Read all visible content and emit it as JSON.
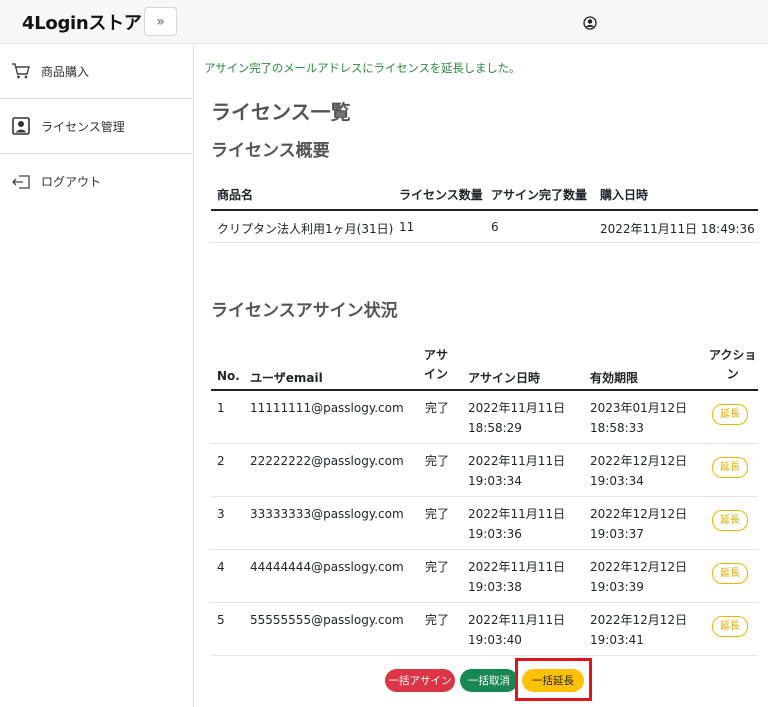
{
  "header": {
    "brand": "4Loginストア",
    "toggle_icon": "chevron-double-right-icon",
    "user_icon": "user-circle-icon"
  },
  "sidebar": {
    "items": [
      {
        "label": "商品購入",
        "icon": "cart-icon"
      },
      {
        "label": "ライセンス管理",
        "icon": "person-badge-icon"
      },
      {
        "label": "ログアウト",
        "icon": "logout-icon"
      }
    ]
  },
  "main": {
    "alert": "アサイン完了のメールアドレスにライセンスを延長しました。",
    "title": "ライセンス一覧",
    "summary": {
      "title": "ライセンス概要",
      "headers": [
        "商品名",
        "ライセンス数量",
        "アサイン完了数量",
        "購入日時"
      ],
      "rows": [
        [
          "クリプタン法人利用1ヶ月(31日)",
          "11",
          "6",
          "2022年11月11日 18:49:36"
        ]
      ]
    },
    "status": {
      "title": "ライセンスアサイン状況",
      "headers": {
        "no": "No.",
        "email": "ユーザemail",
        "assign_l1": "アサ",
        "assign_l2": "イン",
        "assign_date": "アサイン日時",
        "expiry": "有効期限",
        "action_l1": "アクショ",
        "action_l2": "ン"
      },
      "renew_label": "延長",
      "rows": [
        {
          "no": "1",
          "email": "11111111@passlogy.com",
          "assign": "完了",
          "assign_date": "2022年11月11日",
          "assign_time": "18:58:29",
          "expiry_date": "2023年01月12日",
          "expiry_time": "18:58:33"
        },
        {
          "no": "2",
          "email": "22222222@passlogy.com",
          "assign": "完了",
          "assign_date": "2022年11月11日",
          "assign_time": "19:03:34",
          "expiry_date": "2022年12月12日",
          "expiry_time": "19:03:34"
        },
        {
          "no": "3",
          "email": "33333333@passlogy.com",
          "assign": "完了",
          "assign_date": "2022年11月11日",
          "assign_time": "19:03:36",
          "expiry_date": "2022年12月12日",
          "expiry_time": "19:03:37"
        },
        {
          "no": "4",
          "email": "44444444@passlogy.com",
          "assign": "完了",
          "assign_date": "2022年11月11日",
          "assign_time": "19:03:38",
          "expiry_date": "2022年12月12日",
          "expiry_time": "19:03:39"
        },
        {
          "no": "5",
          "email": "55555555@passlogy.com",
          "assign": "完了",
          "assign_date": "2022年11月11日",
          "assign_time": "19:03:40",
          "expiry_date": "2022年12月12日",
          "expiry_time": "19:03:41"
        }
      ]
    },
    "actions": {
      "bulk_assign": "一括アサイン",
      "bulk_cancel": "一括取消",
      "bulk_renew": "一括延長"
    }
  },
  "colors": {
    "alert_text": "#2b8a3e",
    "danger": "#dc3545",
    "success": "#198754",
    "warning": "#ffc107",
    "highlight": "#e0151b"
  }
}
